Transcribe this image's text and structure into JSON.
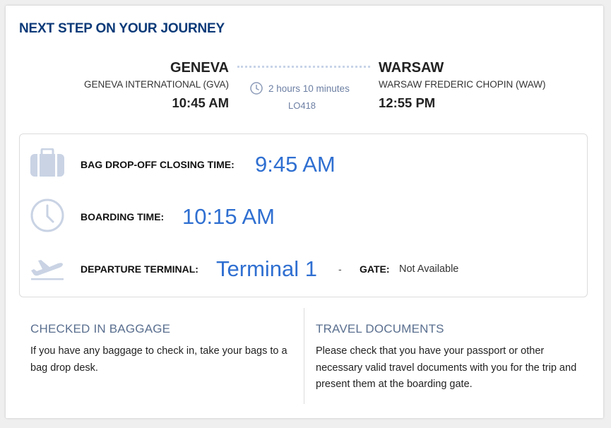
{
  "header": {
    "title": "NEXT STEP ON YOUR JOURNEY"
  },
  "route": {
    "origin": {
      "city": "GENEVA",
      "airport": "GENEVA INTERNATIONAL (GVA)",
      "time": "10:45 AM"
    },
    "destination": {
      "city": "WARSAW",
      "airport": "WARSAW FREDERIC CHOPIN (WAW)",
      "time": "12:55 PM"
    },
    "duration": "2 hours 10 minutes",
    "flight_number": "LO418"
  },
  "details": {
    "bag_drop_label": "BAG DROP-OFF CLOSING TIME:",
    "bag_drop_value": "9:45 AM",
    "boarding_label": "BOARDING TIME:",
    "boarding_value": "10:15 AM",
    "terminal_label": "DEPARTURE TERMINAL:",
    "terminal_value": "Terminal 1",
    "separator": "-",
    "gate_label": "GATE:",
    "gate_value": "Not Available"
  },
  "info": {
    "baggage": {
      "heading": "CHECKED IN BAGGAGE",
      "text": "If you have any baggage to check in, take your bags to a bag drop desk."
    },
    "documents": {
      "heading": "TRAVEL DOCUMENTS",
      "text": "Please check that you have your passport or other necessary valid travel documents with you for the trip and present them at the boarding gate."
    }
  },
  "colors": {
    "title": "#0b3a78",
    "accent": "#2f6fd1",
    "icon": "#c9d3e4",
    "muted": "#6c7fa3"
  },
  "icons": [
    "clock-icon",
    "suitcase-icon",
    "boarding-clock-icon",
    "plane-takeoff-icon"
  ]
}
